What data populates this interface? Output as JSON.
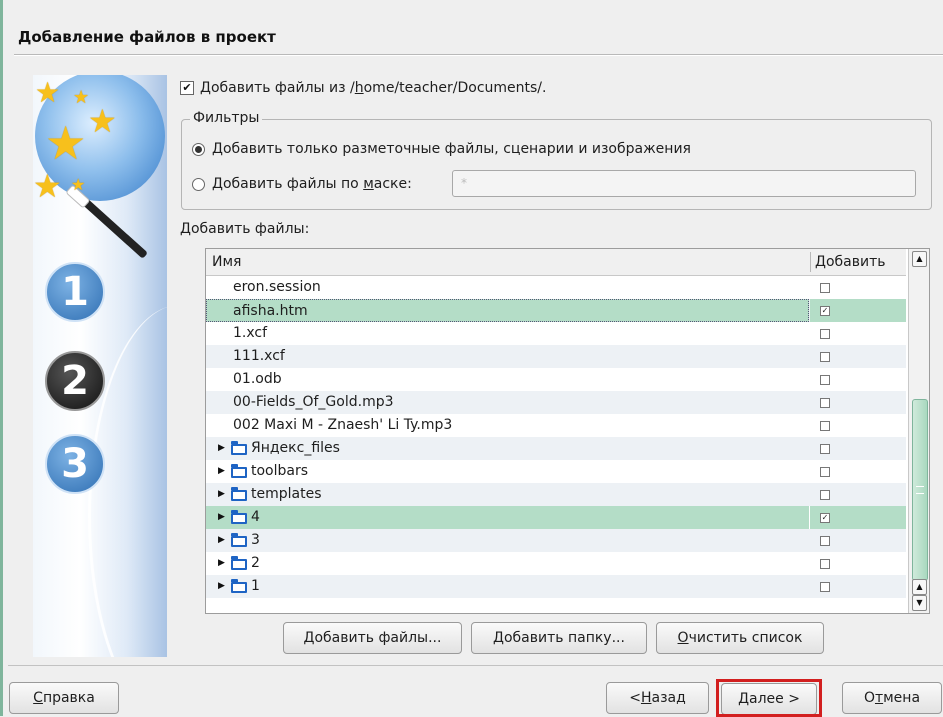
{
  "dialog": {
    "title": "Добавление файлов в проект"
  },
  "add_from": {
    "checked": true,
    "prefix": "Добавить файлы из ",
    "path_mnemonic": "h",
    "path_rest": "ome/teacher/Documents/."
  },
  "filters": {
    "legend": "Фильтры",
    "option1": {
      "mnemonic": "Д",
      "rest": "обавить только разметочные файлы, сценарии и изображения",
      "selected": true
    },
    "option2": {
      "before": "Добавить файлы по ",
      "mnemonic": "м",
      "rest": "аске:",
      "selected": false
    },
    "mask_value": "*"
  },
  "files_label": "Добавить файлы:",
  "table": {
    "col_name": "Имя",
    "col_add": "Добавить",
    "rows": [
      {
        "name": "eron.session",
        "checked": false,
        "folder": false
      },
      {
        "name": "afisha.htm",
        "checked": true,
        "folder": false,
        "selected": true
      },
      {
        "name": "1.xcf",
        "checked": false,
        "folder": false
      },
      {
        "name": "111.xcf",
        "checked": false,
        "folder": false
      },
      {
        "name": "01.odb",
        "checked": false,
        "folder": false
      },
      {
        "name": "00-Fields_Of_Gold.mp3",
        "checked": false,
        "folder": false
      },
      {
        "name": "002 Maxi M - Znaesh' Li Ty.mp3",
        "checked": false,
        "folder": false
      },
      {
        "name": "Яндекс_files",
        "checked": false,
        "folder": true
      },
      {
        "name": "toolbars",
        "checked": false,
        "folder": true
      },
      {
        "name": "templates",
        "checked": false,
        "folder": true
      },
      {
        "name": "4",
        "checked": true,
        "folder": true,
        "selected": true
      },
      {
        "name": "3",
        "checked": false,
        "folder": true
      },
      {
        "name": "2",
        "checked": false,
        "folder": true
      },
      {
        "name": "1",
        "checked": false,
        "folder": true
      }
    ]
  },
  "buttons": {
    "add_files": {
      "mnemonic": "Д",
      "rest": "обавить файлы..."
    },
    "add_folder": {
      "mnemonic": "Д",
      "rest": "обавить папку..."
    },
    "clear_list": {
      "mnemonic": "О",
      "rest": "чистить список"
    },
    "help": {
      "mnemonic": "С",
      "rest": "правка"
    },
    "back": {
      "before": "< ",
      "mnemonic": "Н",
      "rest": "азад"
    },
    "next": {
      "mnemonic": "Д",
      "rest": "алее >"
    },
    "cancel": {
      "before": "О",
      "mnemonic": "т",
      "rest": "мена"
    }
  },
  "wizard_steps": [
    "1",
    "2",
    "3"
  ],
  "colors": {
    "selection": "#b4ddc7",
    "highlight_frame": "#d21f1f"
  },
  "icons": [
    "magic-wand-icon",
    "globe-icon",
    "star-icon",
    "folder-icon",
    "expand-arrow-icon",
    "scroll-up-icon",
    "scroll-down-icon"
  ]
}
